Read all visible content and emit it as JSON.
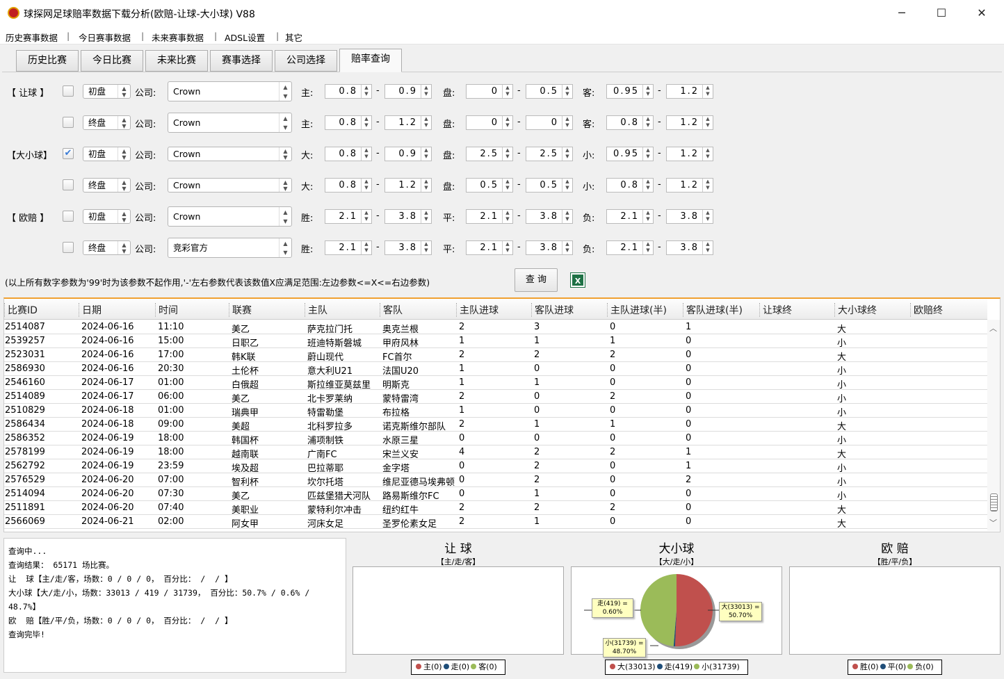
{
  "window": {
    "title": "球探网足球赔率数据下载分析(欧赔-让球-大小球) V88",
    "minimize": "─",
    "maximize": "☐",
    "close": "✕"
  },
  "menu": [
    "历史赛事数据",
    "今日赛事数据",
    "未来赛事数据",
    "ADSL设置",
    "其它"
  ],
  "tabs": [
    {
      "label": "历史比赛"
    },
    {
      "label": "今日比赛"
    },
    {
      "label": "未来比赛"
    },
    {
      "label": "赛事选择"
    },
    {
      "label": "公司选择"
    },
    {
      "label": "赔率查询",
      "active": true
    }
  ],
  "form": {
    "company_label": "公司:",
    "rows": [
      {
        "group": "【 让球 】",
        "checked": false,
        "stage": "初盘",
        "company": "Crown",
        "labels": [
          "主:",
          "盘:",
          "客:"
        ],
        "values": [
          "0.8",
          "0.9",
          "0",
          "0.5",
          "0.95",
          "1.2"
        ]
      },
      {
        "group": "",
        "checked": false,
        "stage": "终盘",
        "company": "Crown",
        "labels": [
          "主:",
          "盘:",
          "客:"
        ],
        "values": [
          "0.8",
          "1.2",
          "0",
          "0",
          "0.8",
          "1.2"
        ]
      },
      {
        "group": "【大小球】",
        "checked": true,
        "stage": "初盘",
        "company": "Crown",
        "labels": [
          "大:",
          "盘:",
          "小:"
        ],
        "values": [
          "0.8",
          "0.9",
          "2.5",
          "2.5",
          "0.95",
          "1.2"
        ]
      },
      {
        "group": "",
        "checked": false,
        "stage": "终盘",
        "company": "Crown",
        "labels": [
          "大:",
          "盘:",
          "小:"
        ],
        "values": [
          "0.8",
          "1.2",
          "0.5",
          "0.5",
          "0.8",
          "1.2"
        ]
      },
      {
        "group": "【 欧赔 】",
        "checked": false,
        "stage": "初盘",
        "company": "Crown",
        "labels": [
          "胜:",
          "平:",
          "负:"
        ],
        "values": [
          "2.1",
          "3.8",
          "2.1",
          "3.8",
          "2.1",
          "3.8"
        ]
      },
      {
        "group": "",
        "checked": false,
        "stage": "终盘",
        "company": "竞彩官方",
        "labels": [
          "胜:",
          "平:",
          "负:"
        ],
        "values": [
          "2.1",
          "3.8",
          "2.1",
          "3.8",
          "2.1",
          "3.8"
        ]
      }
    ],
    "hint": "(以上所有数字参数为'99'时为该参数不起作用,'-'左右参数代表该数值X应满足范围:左边参数<=X<=右边参数)",
    "query_button": "查 询",
    "excel_icon": "excel-icon"
  },
  "table": {
    "columns": [
      "比赛ID",
      "日期",
      "时间",
      "联赛",
      "主队",
      "客队",
      "主队进球",
      "客队进球",
      "主队进球(半)",
      "客队进球(半)",
      "让球终",
      "大小球终",
      "欧赔终"
    ],
    "rows": [
      [
        "2514087",
        "2024-06-16",
        "11:10",
        "美乙",
        "萨克拉门托",
        "奥克兰根",
        "2",
        "3",
        "0",
        "1",
        "",
        "大",
        ""
      ],
      [
        "2539257",
        "2024-06-16",
        "15:00",
        "日职乙",
        "班迪特斯磐城",
        "甲府风林",
        "1",
        "1",
        "1",
        "0",
        "",
        "小",
        ""
      ],
      [
        "2523031",
        "2024-06-16",
        "17:00",
        "韩K联",
        "蔚山现代",
        "FC首尔",
        "2",
        "2",
        "2",
        "0",
        "",
        "大",
        ""
      ],
      [
        "2586930",
        "2024-06-16",
        "20:30",
        "土伦杯",
        "意大利U21",
        "法国U20",
        "1",
        "0",
        "0",
        "0",
        "",
        "小",
        ""
      ],
      [
        "2546160",
        "2024-06-17",
        "01:00",
        "白俄超",
        "斯拉维亚莫兹里",
        "明斯克",
        "1",
        "1",
        "0",
        "0",
        "",
        "小",
        ""
      ],
      [
        "2514089",
        "2024-06-17",
        "06:00",
        "美乙",
        "北卡罗莱纳",
        "蒙特雷湾",
        "2",
        "0",
        "2",
        "0",
        "",
        "小",
        ""
      ],
      [
        "2510829",
        "2024-06-18",
        "01:00",
        "瑞典甲",
        "特雷勒堡",
        "布拉格",
        "1",
        "0",
        "0",
        "0",
        "",
        "小",
        ""
      ],
      [
        "2586434",
        "2024-06-18",
        "09:00",
        "美超",
        "北科罗拉多",
        "诺克斯维尔部队",
        "2",
        "1",
        "1",
        "0",
        "",
        "大",
        ""
      ],
      [
        "2586352",
        "2024-06-19",
        "18:00",
        "韩国杯",
        "浦项制铁",
        "水原三星",
        "0",
        "0",
        "0",
        "0",
        "",
        "小",
        ""
      ],
      [
        "2578199",
        "2024-06-19",
        "18:00",
        "越南联",
        "广南FC",
        "宋兰义安",
        "4",
        "2",
        "2",
        "1",
        "",
        "大",
        ""
      ],
      [
        "2562792",
        "2024-06-19",
        "23:59",
        "埃及超",
        "巴拉蒂耶",
        "金字塔",
        "0",
        "2",
        "0",
        "1",
        "",
        "小",
        ""
      ],
      [
        "2576529",
        "2024-06-20",
        "07:00",
        "智利杯",
        "坎尔托塔",
        "维尼亚德马埃弗顿",
        "0",
        "2",
        "0",
        "2",
        "",
        "小",
        ""
      ],
      [
        "2514094",
        "2024-06-20",
        "07:30",
        "美乙",
        "匹兹堡猎犬河队",
        "路易斯维尔FC",
        "0",
        "1",
        "0",
        "0",
        "",
        "小",
        ""
      ],
      [
        "2511891",
        "2024-06-20",
        "07:40",
        "美职业",
        "蒙特利尔冲击",
        "纽约红牛",
        "2",
        "2",
        "2",
        "0",
        "",
        "大",
        ""
      ],
      [
        "2566069",
        "2024-06-21",
        "02:00",
        "阿女甲",
        "河床女足",
        "圣罗伦素女足",
        "2",
        "1",
        "0",
        "0",
        "",
        "大",
        ""
      ]
    ]
  },
  "log": [
    "查询中...",
    "查询结果： 65171 场比赛。",
    "让  球【主/走/客，场数：0 / 0 / 0， 百分比： /  / 】",
    "大小球【大/走/小，场数：33013 / 419 / 31739， 百分比：50.7% / 0.6% / 48.7%】",
    "欧  赔【胜/平/负，场数：0 / 0 / 0， 百分比： /  / 】",
    "查询完毕!"
  ],
  "colors": {
    "red": "#c0504d",
    "blue": "#1f4e79",
    "green": "#9bbb59",
    "accent": "#f0a030"
  },
  "charts": [
    {
      "title": "让 球",
      "subtitle": "【主/走/客】",
      "legend": [
        "主(0)",
        "走(0)",
        "客(0)"
      ],
      "values": [
        0,
        0,
        0
      ],
      "labels": []
    },
    {
      "title": "大小球",
      "subtitle": "【大/走/小】",
      "legend": [
        "大(33013)",
        "走(419)",
        "小(31739)"
      ],
      "values": [
        33013,
        419,
        31739
      ],
      "labels": [
        "大(33013) =",
        "50.70%",
        "走(419) =",
        "0.60%",
        "小(31739) =",
        "48.70%"
      ]
    },
    {
      "title": "欧 赔",
      "subtitle": "【胜/平/负】",
      "legend": [
        "胜(0)",
        "平(0)",
        "负(0)"
      ],
      "values": [
        0,
        0,
        0
      ],
      "labels": []
    }
  ]
}
